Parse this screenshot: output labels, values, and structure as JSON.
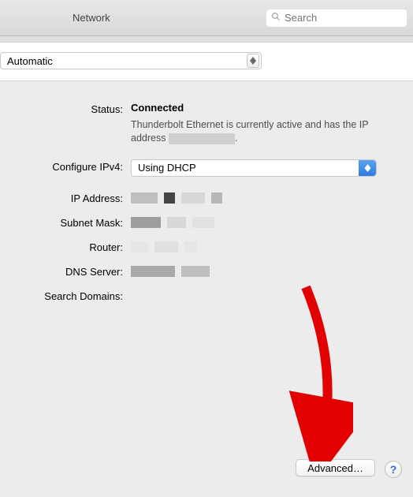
{
  "header": {
    "title": "Network",
    "search_placeholder": "Search"
  },
  "location": {
    "selected": "Automatic"
  },
  "status": {
    "label": "Status:",
    "value": "Connected",
    "subtext_prefix": "Thunderbolt Ethernet is currently active and has the IP address ",
    "subtext_suffix": "."
  },
  "fields": {
    "configure_ipv4": {
      "label": "Configure IPv4:",
      "value": "Using DHCP"
    },
    "ip_address": {
      "label": "IP Address:"
    },
    "subnet_mask": {
      "label": "Subnet Mask:"
    },
    "router": {
      "label": "Router:"
    },
    "dns_server": {
      "label": "DNS Server:"
    },
    "search_domains": {
      "label": "Search Domains:"
    }
  },
  "buttons": {
    "advanced": "Advanced…",
    "help": "?"
  }
}
